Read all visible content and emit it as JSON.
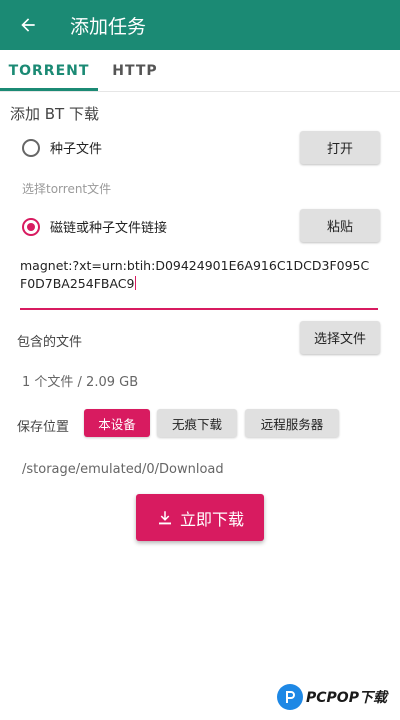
{
  "appbar": {
    "title": "添加任务"
  },
  "tabs": [
    {
      "label": "TORRENT",
      "active": true
    },
    {
      "label": "HTTP",
      "active": false
    }
  ],
  "section": {
    "title": "添加 BT 下载"
  },
  "torrent_option": {
    "label": "种子文件",
    "checked": false,
    "button": "打开",
    "hint": "选择torrent文件"
  },
  "magnet_option": {
    "label": "磁链或种子文件链接",
    "checked": true,
    "button": "粘贴"
  },
  "magnet_input": {
    "value": "magnet:?xt=urn:btih:D09424901E6A916C1DCD3F095CF0D7BA254FBAC9"
  },
  "files": {
    "label": "包含的文件",
    "button": "选择文件",
    "info": "1 个文件 / 2.09 GB"
  },
  "save_location": {
    "label": "保存位置",
    "options": [
      {
        "label": "本设备",
        "active": true
      },
      {
        "label": "无痕下载",
        "active": false
      },
      {
        "label": "远程服务器",
        "active": false
      }
    ],
    "path": "/storage/emulated/0/Download"
  },
  "download_button": {
    "label": "立即下载"
  },
  "watermark": {
    "text": "PCPOP下载"
  },
  "colors": {
    "primary": "#1b8a74",
    "accent": "#d81b60",
    "button_gray": "#e0e0e0"
  },
  "icons": {
    "back": "arrow-left-icon",
    "download": "download-icon",
    "watermark": "pcpop-logo-icon"
  }
}
